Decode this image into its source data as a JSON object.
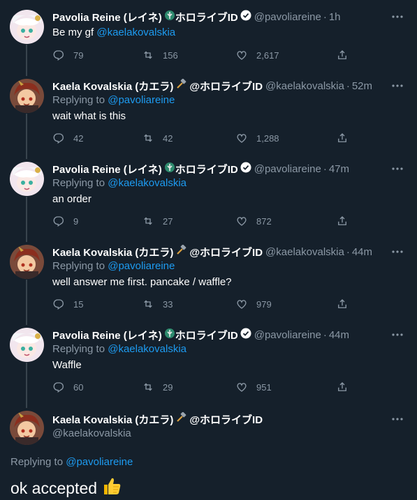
{
  "tweets": [
    {
      "name": "Pavolia Reine (レイネ)",
      "name_suffix": "ホロライブID",
      "handle": "@pavoliareine",
      "time": "1h",
      "replying_prefix": "",
      "replying_to": "",
      "text": "Be my gf ",
      "text_mention": "@kaelakovalskia",
      "replies": "79",
      "retweets": "156",
      "likes": "2,617",
      "colors": {
        "avatar_bg": "#f2e6ee",
        "hair": "#f5f5f8",
        "accent": "#3ab0a0"
      }
    },
    {
      "name": "Kaela Kovalskia (カエラ)",
      "name_suffix": "@ホロライブID",
      "handle": "@kaelakovalskia",
      "time": "52m",
      "replying_prefix": "Replying to ",
      "replying_to": "@pavoliareine",
      "text": "wait what is this",
      "text_mention": "",
      "replies": "42",
      "retweets": "42",
      "likes": "1,288",
      "colors": {
        "avatar_bg": "#d98a6e",
        "hair": "#8b2e1e",
        "accent": "#f3c9a2"
      }
    },
    {
      "name": "Pavolia Reine (レイネ)",
      "name_suffix": "ホロライブID",
      "handle": "@pavoliareine",
      "time": "47m",
      "replying_prefix": "Replying to ",
      "replying_to": "@kaelakovalskia",
      "text": "an order",
      "text_mention": "",
      "replies": "9",
      "retweets": "27",
      "likes": "872"
    },
    {
      "name": "Kaela Kovalskia (カエラ)",
      "name_suffix": "@ホロライブID",
      "handle": "@kaelakovalskia",
      "time": "44m",
      "replying_prefix": "Replying to ",
      "replying_to": "@pavoliareine",
      "text": "well answer me first. pancake / waffle?",
      "text_mention": "",
      "replies": "15",
      "retweets": "33",
      "likes": "979"
    },
    {
      "name": "Pavolia Reine (レイネ)",
      "name_suffix": "ホロライブID",
      "handle": "@pavoliareine",
      "time": "44m",
      "replying_prefix": "Replying to ",
      "replying_to": "@kaelakovalskia",
      "text": "Waffle",
      "text_mention": "",
      "replies": "60",
      "retweets": "29",
      "likes": "951"
    }
  ],
  "focused": {
    "name": "Kaela Kovalskia (カエラ)",
    "name_suffix": "@ホロライブID",
    "handle": "@kaelakovalskia",
    "replying_prefix": "Replying to ",
    "replying_to": "@pavoliareine",
    "text": "ok accepted"
  },
  "icons": {
    "reply": "reply-icon",
    "retweet": "retweet-icon",
    "like": "heart-icon",
    "share": "share-icon",
    "more": "more-icon",
    "verified": "verified-icon",
    "hammer": "hammer-icon",
    "peacock": "peacock-icon",
    "thumbs_up": "thumbs-up-icon"
  },
  "theme": {
    "background": "#15202b",
    "muted": "#8b98a5",
    "link": "#1d9bf0",
    "line": "#38444d"
  }
}
